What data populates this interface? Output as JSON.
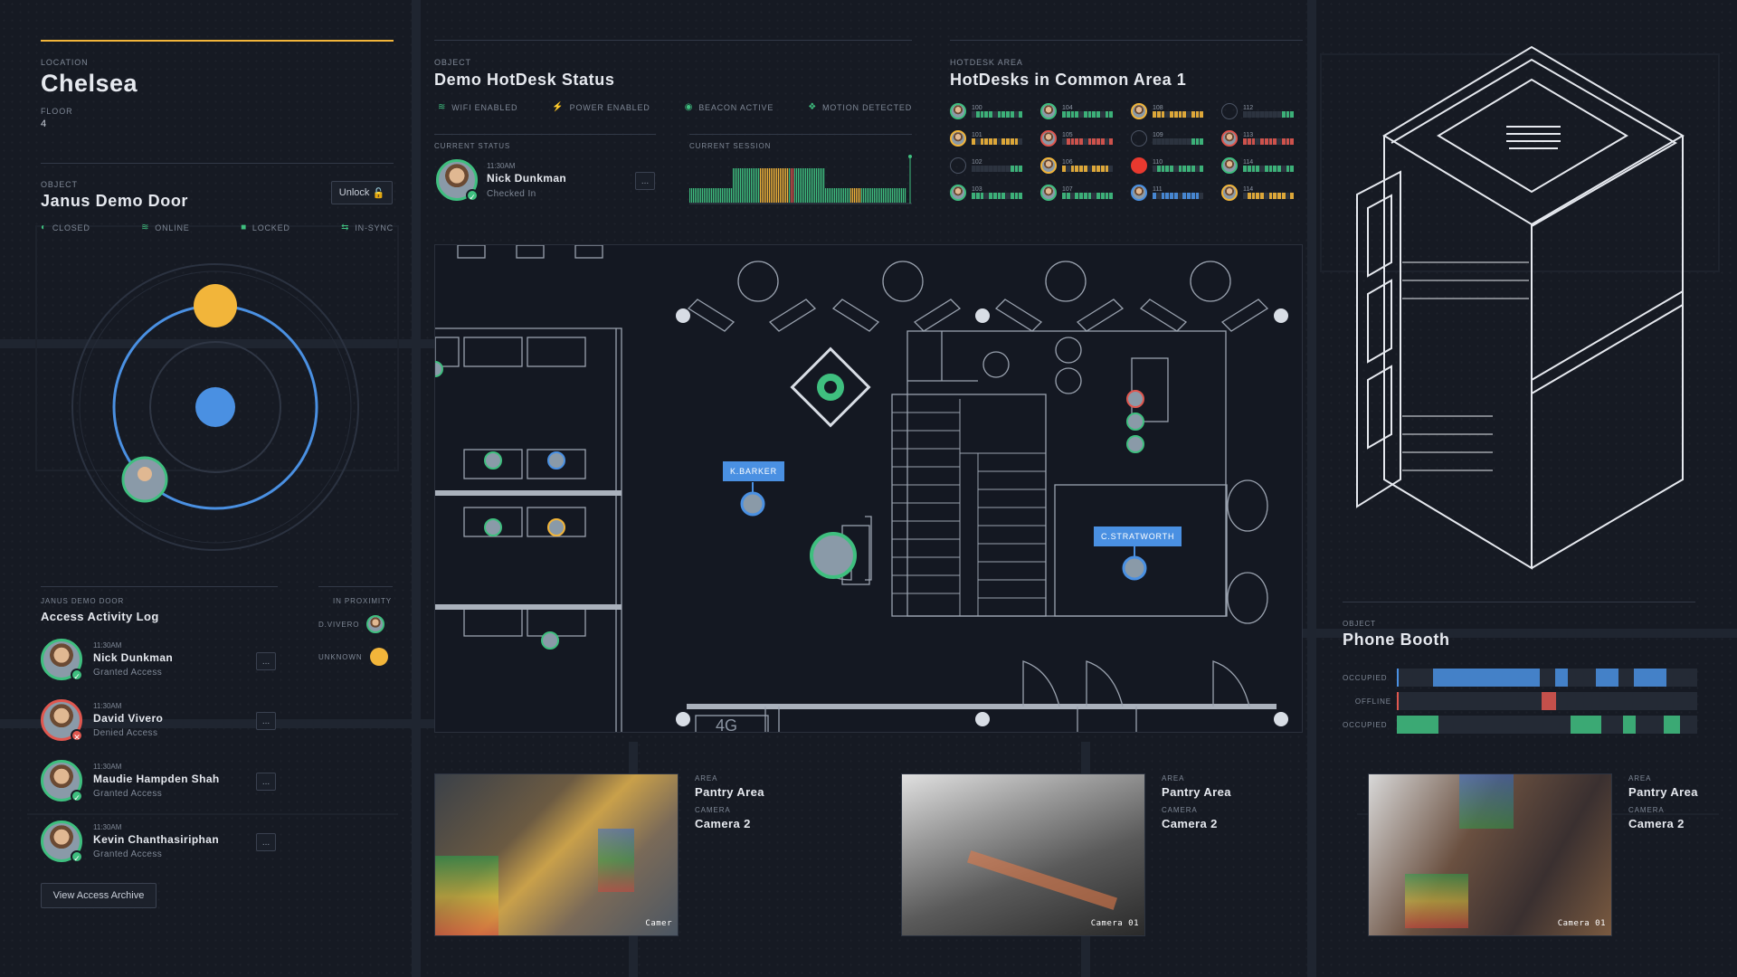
{
  "location": {
    "caption": "LOCATION",
    "name": "Chelsea",
    "floor_caption": "FLOOR",
    "floor": "4"
  },
  "door": {
    "caption": "OBJECT",
    "title": "Janus Demo Door",
    "unlock_label": "Unlock",
    "statuses": [
      {
        "icon": "half-circle-icon",
        "label": "CLOSED"
      },
      {
        "icon": "wifi-icon",
        "label": "ONLINE"
      },
      {
        "icon": "lock-icon",
        "label": "LOCKED"
      },
      {
        "icon": "sync-icon",
        "label": "IN-SYNC"
      }
    ]
  },
  "hotdesk": {
    "caption": "OBJECT",
    "title": "Demo HotDesk Status",
    "statuses": [
      {
        "icon": "wifi-icon",
        "label": "WIFI ENABLED"
      },
      {
        "icon": "power-icon",
        "label": "POWER ENABLED"
      },
      {
        "icon": "beacon-icon",
        "label": "BEACON ACTIVE"
      },
      {
        "icon": "motion-icon",
        "label": "MOTION DETECTED"
      }
    ],
    "current_status_caption": "CURRENT STATUS",
    "current_session_caption": "CURRENT SESSION",
    "time": "11:30AM",
    "person": "Nick Dunkman",
    "status": "Checked In",
    "more_label": "..."
  },
  "hotdesks_area": {
    "caption": "HOTDESK AREA",
    "title": "HotDesks in Common Area 1",
    "desks": [
      {
        "num": "100",
        "state": "g"
      },
      {
        "num": "101",
        "state": "y"
      },
      {
        "num": "102",
        "state": "empty"
      },
      {
        "num": "103",
        "state": "g"
      },
      {
        "num": "104",
        "state": "g"
      },
      {
        "num": "105",
        "state": "r"
      },
      {
        "num": "106",
        "state": "y"
      },
      {
        "num": "107",
        "state": "g"
      },
      {
        "num": "108",
        "state": "y"
      },
      {
        "num": "109",
        "state": "empty"
      },
      {
        "num": "110",
        "state": "redfill"
      },
      {
        "num": "111",
        "state": "b"
      },
      {
        "num": "112",
        "state": "empty"
      },
      {
        "num": "113",
        "state": "r"
      },
      {
        "num": "114",
        "state": "g"
      },
      {
        "num": "114",
        "state": "y"
      }
    ]
  },
  "access_log": {
    "caption": "JANUS DEMO DOOR",
    "title": "Access Activity Log",
    "entries": [
      {
        "time": "11:30AM",
        "name": "Nick Dunkman",
        "status": "Granted Access",
        "result": "granted"
      },
      {
        "time": "11:30AM",
        "name": "David Vivero",
        "status": "Denied Access",
        "result": "denied"
      },
      {
        "time": "11:30AM",
        "name": "Maudie Hampden Shah",
        "status": "Granted Access",
        "result": "granted"
      },
      {
        "time": "11:30AM",
        "name": "Kevin Chanthasiriphan",
        "status": "Granted Access",
        "result": "granted"
      }
    ],
    "archive_label": "View Access Archive",
    "more_label": "..."
  },
  "proximity": {
    "caption": "IN PROXIMITY",
    "items": [
      {
        "label": "D.VIVERO"
      },
      {
        "label": "UNKNOWN"
      }
    ]
  },
  "map": {
    "tags": [
      {
        "label": "K.BARKER"
      },
      {
        "label": "C.STRATWORTH"
      }
    ],
    "room_label": "4G"
  },
  "phone_booth": {
    "caption": "OBJECT",
    "title": "Phone Booth",
    "rows": [
      {
        "label": "OCCUPIED"
      },
      {
        "label": "OFFLINE"
      },
      {
        "label": "OCCUPIED"
      }
    ]
  },
  "cameras": [
    {
      "area_caption": "AREA",
      "area": "Pantry Area",
      "camera_caption": "CAMERA",
      "camera": "Camera 2",
      "overlay": "Camer"
    },
    {
      "area_caption": "AREA",
      "area": "Pantry Area",
      "camera_caption": "CAMERA",
      "camera": "Camera 2",
      "overlay": "Camera 01"
    },
    {
      "area_caption": "AREA",
      "area": "Pantry Area",
      "camera_caption": "CAMERA",
      "camera": "Camera 2",
      "overlay": "Camera 01"
    }
  ],
  "colors": {
    "accent_yellow": "#f2b53a",
    "green": "#3fbf7f",
    "red": "#e0574f",
    "blue": "#4a90e2",
    "bg": "#161a23"
  }
}
